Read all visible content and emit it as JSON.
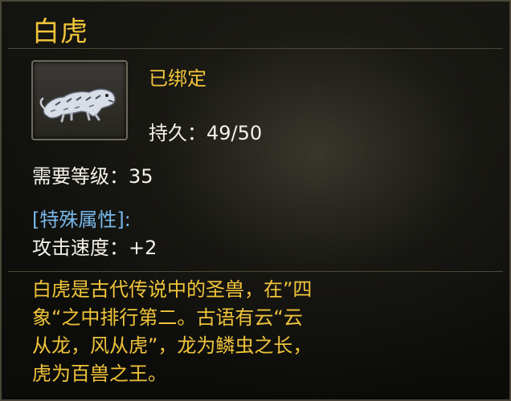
{
  "item": {
    "name": "白虎",
    "bind_status": "已绑定",
    "durability": "持久：49/50",
    "required_level": "需要等级：35",
    "special_attributes_header": "[特殊属性]:",
    "attack_speed": "攻击速度：+2",
    "description_lines": [
      "白虎是古代传说中的圣兽，在”四",
      "象“之中排行第二。古语有云“云",
      "从龙，风从虎”，龙为鳞虫之长，",
      "虎为百兽之王。"
    ],
    "icon": "white-tiger-icon"
  },
  "colors": {
    "title": "#f0c43a",
    "special": "#79b8ea",
    "text": "#f4f2ea"
  }
}
